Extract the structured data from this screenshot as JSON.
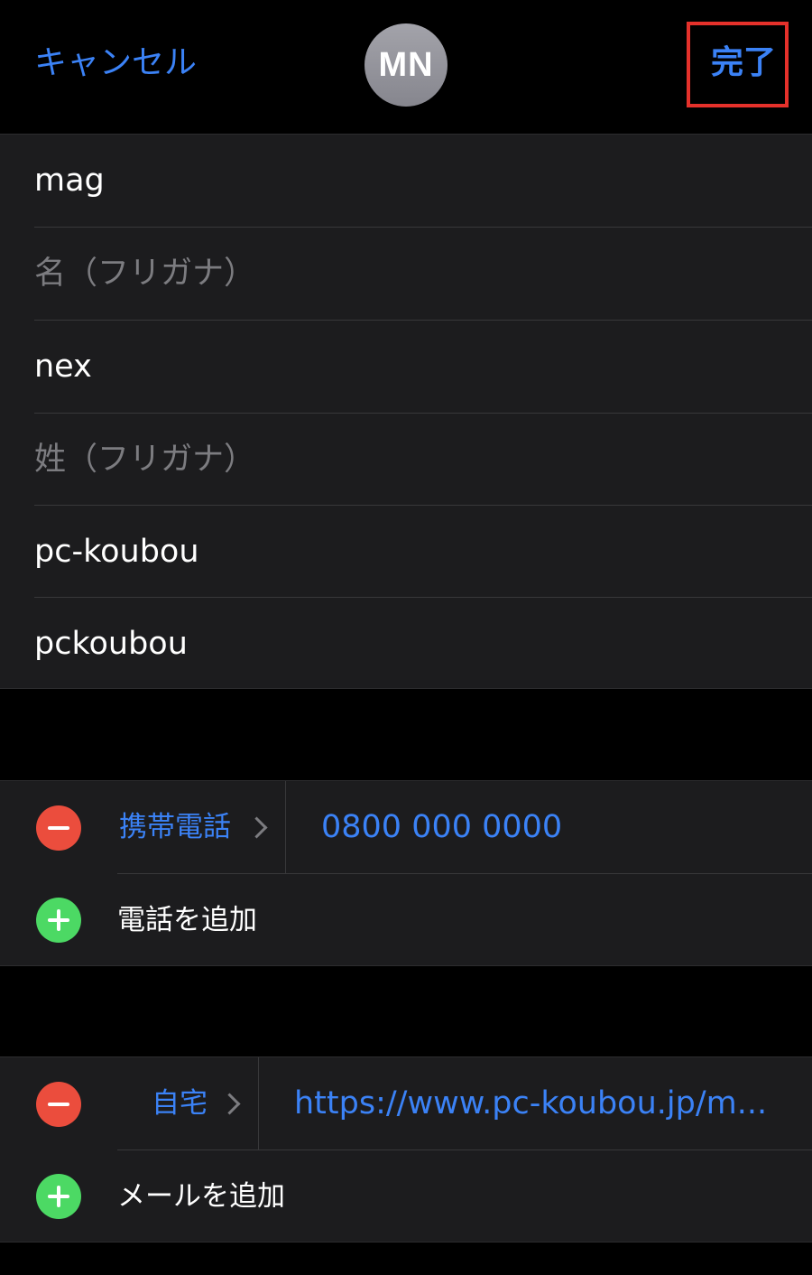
{
  "nav": {
    "cancel_label": "キャンセル",
    "avatar_initials": "MN",
    "done_label": "完了",
    "highlight_color": "#e5312b",
    "accent_color": "#3b82f6"
  },
  "name_fields": [
    {
      "value": "mag",
      "state": "filled"
    },
    {
      "value": "名（フリガナ）",
      "state": "placeholder"
    },
    {
      "value": "nex",
      "state": "filled"
    },
    {
      "value": "姓（フリガナ）",
      "state": "placeholder"
    },
    {
      "value": "pc-koubou",
      "state": "filled"
    },
    {
      "value": "pckoubou",
      "state": "filled"
    }
  ],
  "phone": {
    "label": "携帯電話",
    "value": "0800 000 0000",
    "add_label": "電話を追加"
  },
  "email": {
    "label": "自宅",
    "value": "https://www.pc-koubou.jp/m...",
    "add_label": "メールを追加"
  },
  "icons": {
    "remove": "minus-circle-icon",
    "add": "plus-circle-icon",
    "chevron": "chevron-right-icon"
  }
}
